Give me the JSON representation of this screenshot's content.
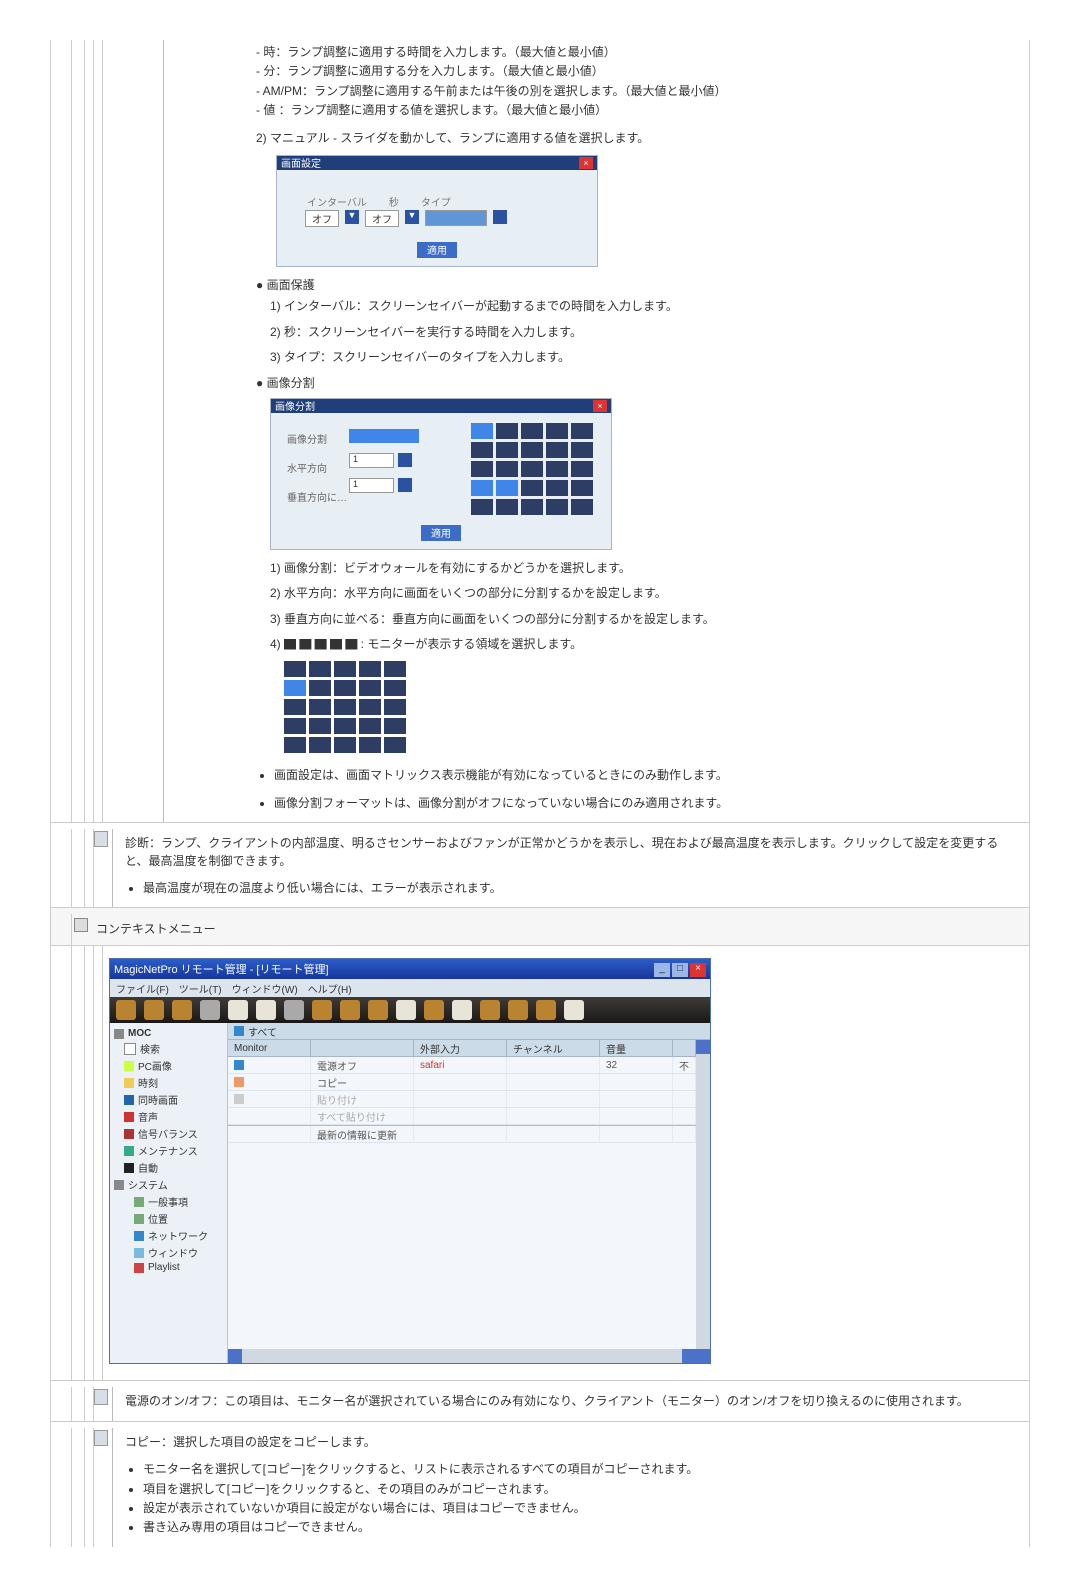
{
  "lampAdjust": {
    "items": [
      "時：ランプ調整に適用する時間を入力します。（最大値と最小値）",
      "分：ランプ調整に適用する分を入力します。（最大値と最小値）",
      "AM/PM：ランプ調整に適用する午前または午後の別を選択します。（最大値と最小値）",
      "値 ：ランプ調整に適用する値を選択します。（最大値と最小値）"
    ],
    "manual": "2) マニュアル - スライダを動かして、ランプに適用する値を選択します。"
  },
  "dialog1": {
    "title": "画面設定",
    "labels": {
      "interval": "インターバル",
      "sec": "秒",
      "type": "タイプ"
    },
    "values": {
      "a": "オフ",
      "b": "オフ"
    },
    "btn": "適用"
  },
  "screenProtect": {
    "heading": "画面保護",
    "items": [
      "1) インターバル：スクリーンセイバーが起動するまでの時間を入力します。",
      "2) 秒：スクリーンセイバーを実行する時間を入力します。",
      "3) タイプ：スクリーンセイバーのタイプを入力します。"
    ]
  },
  "imageDivide": {
    "heading": "画像分割",
    "dialogTitle": "画像分割",
    "labels": {
      "a": "画像分割",
      "b": "水平方向",
      "c": "垂直方向に…"
    },
    "btn": "適用",
    "items": [
      "1) 画像分割：ビデオウォールを有効にするかどうかを選択します。",
      "2) 水平方向：水平方向に画面をいくつの部分に分割するかを設定します。",
      "3) 垂直方向に並べる：垂直方向に画面をいくつの部分に分割するかを設定します。",
      "4) ▇ ▇ ▇ ▇ ▇ : モニターが表示する領域を選択します。"
    ],
    "notes": [
      "画面設定は、画面マトリックス表示機能が有効になっているときにのみ動作します。",
      "画像分割フォーマットは、画像分割がオフになっていない場合にのみ適用されます。"
    ]
  },
  "diag": {
    "text": "診断：ランプ、クライアントの内部温度、明るさセンサーおよびファンが正常かどうかを表示し、現在および最高温度を表示します。クリックして設定を変更すると、最高温度を制御できます。",
    "note": "最高温度が現在の温度より低い場合には、エラーが表示されます。"
  },
  "context": {
    "heading": "コンテキストメニュー",
    "app": {
      "title": "MagicNetPro リモート管理 - [リモート管理]",
      "menus": [
        "ファイル(F)",
        "ツール(T)",
        "ウィンドウ(W)",
        "ヘルプ(H)"
      ],
      "tree": {
        "root": "MOC",
        "items": [
          "検索",
          "PC画像",
          "時刻",
          "同時画面",
          "音声",
          "信号バランス",
          "メンテナンス",
          "自動",
          "システム"
        ],
        "sysChildren": [
          "一般事項",
          "位置",
          "ネットワーク",
          "ウィンドウ",
          "Playlist"
        ]
      },
      "listTab": "すべて",
      "columns": [
        "Monitor",
        "",
        "外部入力",
        "チャンネル",
        "音量",
        ""
      ],
      "rows": [
        {
          "c0": "",
          "c1": "電源オフ",
          "c2": "safari",
          "c3": "",
          "c4": "32",
          "c5": "不"
        },
        {
          "c0": "",
          "c1": "コピー",
          "c2": "",
          "c3": "",
          "c4": "",
          "c5": ""
        },
        {
          "c0": "",
          "c1": "貼り付け",
          "c2": "",
          "c3": "",
          "c4": "",
          "c5": ""
        },
        {
          "c0": "",
          "c1": "すべて貼り付け",
          "c2": "",
          "c3": "",
          "c4": "",
          "c5": ""
        },
        {
          "c0": "",
          "c1": "最新の情報に更新",
          "c2": "",
          "c3": "",
          "c4": "",
          "c5": ""
        }
      ]
    }
  },
  "power": {
    "text": "電源のオン/オフ：この項目は、モニター名が選択されている場合にのみ有効になり、クライアント（モニター）のオン/オフを切り換えるのに使用されます。"
  },
  "copy": {
    "heading": "コピー：選択した項目の設定をコピーします。",
    "items": [
      "モニター名を選択して[コピー]をクリックすると、リストに表示されるすべての項目がコピーされます。",
      "項目を選択して[コピー]をクリックすると、その項目のみがコピーされます。",
      "設定が表示されていないか項目に設定がない場合には、項目はコピーできません。",
      "書き込み専用の項目はコピーできません。"
    ]
  }
}
